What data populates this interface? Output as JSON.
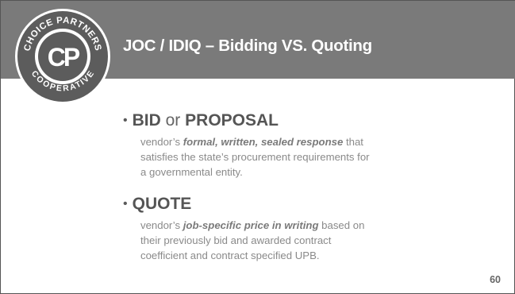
{
  "slide": {
    "title": "JOC / IDIQ – Bidding VS. Quoting",
    "page_number": "60"
  },
  "logo": {
    "top_text": "CHOICE PARTNERS",
    "bottom_text": "COOPERATIVE",
    "monogram": "CP"
  },
  "bullets": [
    {
      "term_a": "BID",
      "connector": "or",
      "term_b": "PROPOSAL",
      "lines": [
        {
          "prefix": "vendor’s ",
          "emph": "formal,  written,  sealed response",
          "suffix": "  that"
        },
        {
          "text": "satisfies the state’s procurement requirements for"
        },
        {
          "text": "a governmental  entity."
        }
      ]
    },
    {
      "term": "QUOTE",
      "lines": [
        {
          "prefix": "vendor’s ",
          "emph": "job-specific  price in writing",
          "suffix": "  based on"
        },
        {
          "text": "their previously bid and awarded contract"
        },
        {
          "text": "coefficient and contract specified UPB."
        }
      ]
    }
  ],
  "colors": {
    "title_bar": "#7a7a7a",
    "title_text": "#ffffff",
    "logo_ring": "#5a5a5a"
  }
}
